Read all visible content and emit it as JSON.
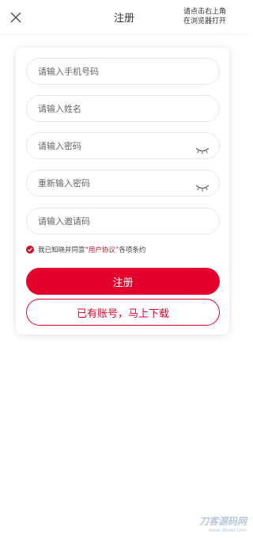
{
  "header": {
    "title": "注册",
    "hint_line1": "请点击右上角",
    "hint_line2": "在浏览器打开"
  },
  "form": {
    "phone_placeholder": "请输入手机号码",
    "name_placeholder": "请输入姓名",
    "password_placeholder": "请输入密码",
    "confirm_placeholder": "重新输入密码",
    "invite_placeholder": "请输入邀请码"
  },
  "agreement": {
    "prefix": "我已知晓并同意",
    "link": "“用户协议”",
    "suffix": "各项条约"
  },
  "buttons": {
    "register": "注册",
    "login_download": "已有账号，马上下载"
  },
  "watermark": {
    "line1": "刀客源码网",
    "line2": "www.dkewl.com"
  },
  "colors": {
    "accent": "#e4002b"
  }
}
